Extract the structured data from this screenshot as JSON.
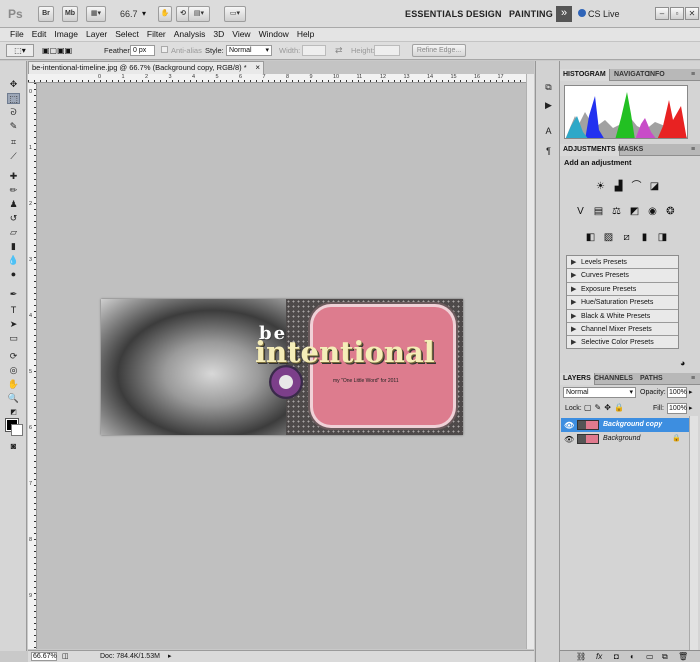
{
  "app": {
    "logo": "Ps",
    "bridge_label": "Br",
    "minibridge_label": "Mb",
    "zoom_value": "66.7",
    "workspaces": [
      "ESSENTIALS",
      "DESIGN",
      "PAINTING"
    ],
    "more_workspaces": "»",
    "cs_live": "CS Live",
    "window_minimize": "–",
    "window_restore": "▫",
    "window_close": "✕"
  },
  "menu": [
    "File",
    "Edit",
    "Image",
    "Layer",
    "Select",
    "Filter",
    "Analysis",
    "3D",
    "View",
    "Window",
    "Help"
  ],
  "options": {
    "feather_label": "Feather:",
    "feather_value": "0 px",
    "antialias_label": "Anti-alias",
    "style_label": "Style:",
    "style_value": "Normal",
    "width_label": "Width:",
    "height_label": "Height:",
    "refine_edge": "Refine Edge..."
  },
  "document": {
    "tab_title": "be-intentional-timeline.jpg @ 66.7% (Background copy, RGB/8) *",
    "tab_close": "×",
    "artwork_be": "be",
    "artwork_title": "intentional",
    "artwork_subtitle": "my \"One Little Word\" for 2011",
    "ruler_top_numbers": [
      "0",
      "1",
      "2",
      "3",
      "4",
      "5",
      "6",
      "7",
      "8",
      "9",
      "10",
      "11",
      "12",
      "13",
      "14",
      "15",
      "16",
      "17"
    ],
    "ruler_left_numbers": [
      "0",
      "1",
      "2",
      "3",
      "4",
      "5",
      "6",
      "7",
      "8",
      "9"
    ]
  },
  "status": {
    "zoom": "66.67%",
    "doc_info": "Doc: 784.4K/1.53M"
  },
  "panels": {
    "histogram_tabs": [
      "HISTOGRAM",
      "NAVIGATO",
      "INFO"
    ],
    "adjustments_tabs": [
      "ADJUSTMENTS",
      "MASKS"
    ],
    "adjustments_heading": "Add an adjustment",
    "presets": [
      "Levels Presets",
      "Curves Presets",
      "Exposure Presets",
      "Hue/Saturation Presets",
      "Black & White Presets",
      "Channel Mixer Presets",
      "Selective Color Presets"
    ],
    "layers_tabs": [
      "LAYERS",
      "CHANNELS",
      "PATHS"
    ],
    "blend_mode": "Normal",
    "opacity_label": "Opacity:",
    "opacity_value": "100%",
    "lock_label": "Lock:",
    "fill_label": "Fill:",
    "fill_value": "100%",
    "layers": [
      {
        "name": "Background copy",
        "selected": true,
        "locked": false
      },
      {
        "name": "Background",
        "selected": false,
        "locked": true
      }
    ]
  }
}
